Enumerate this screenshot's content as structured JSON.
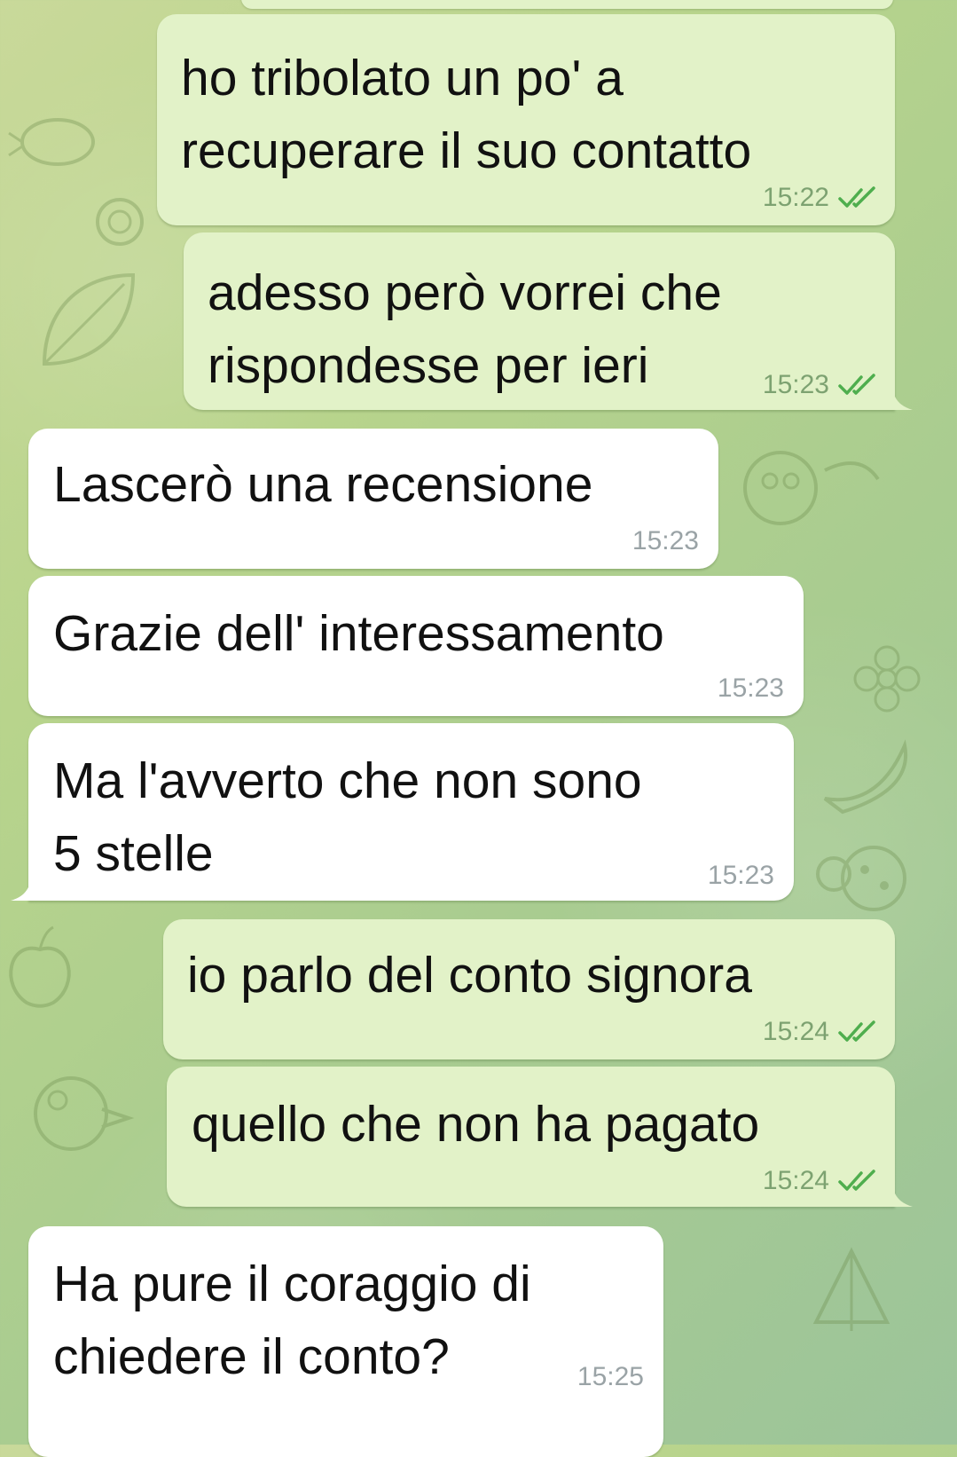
{
  "colors": {
    "outgoing_bubble": "#e2f2c8",
    "incoming_bubble": "#ffffff",
    "outgoing_meta": "#7da271",
    "incoming_meta": "#9aa3a6",
    "read_ticks": "#4fae4e"
  },
  "messages": [
    {
      "direction": "outgoing",
      "text": "ho tribolato un po' a\nrecuperare il suo contatto",
      "time": "15:22",
      "status_icon": "double-check-icon"
    },
    {
      "direction": "outgoing",
      "text": "adesso però vorrei che\nrispondesse per ieri",
      "time": "15:23",
      "status_icon": "double-check-icon"
    },
    {
      "direction": "incoming",
      "text": "Lascerò una recensione",
      "time": "15:23"
    },
    {
      "direction": "incoming",
      "text": "Grazie dell' interessamento",
      "time": "15:23"
    },
    {
      "direction": "incoming",
      "text": "Ma l'avverto che non sono\n5 stelle",
      "time": "15:23"
    },
    {
      "direction": "outgoing",
      "text": "io parlo del conto signora",
      "time": "15:24",
      "status_icon": "double-check-icon"
    },
    {
      "direction": "outgoing",
      "text": "quello che non ha pagato",
      "time": "15:24",
      "status_icon": "double-check-icon"
    },
    {
      "direction": "incoming",
      "text": "Ha pure il coraggio di\nchiedere il conto?",
      "time": "15:25"
    }
  ]
}
